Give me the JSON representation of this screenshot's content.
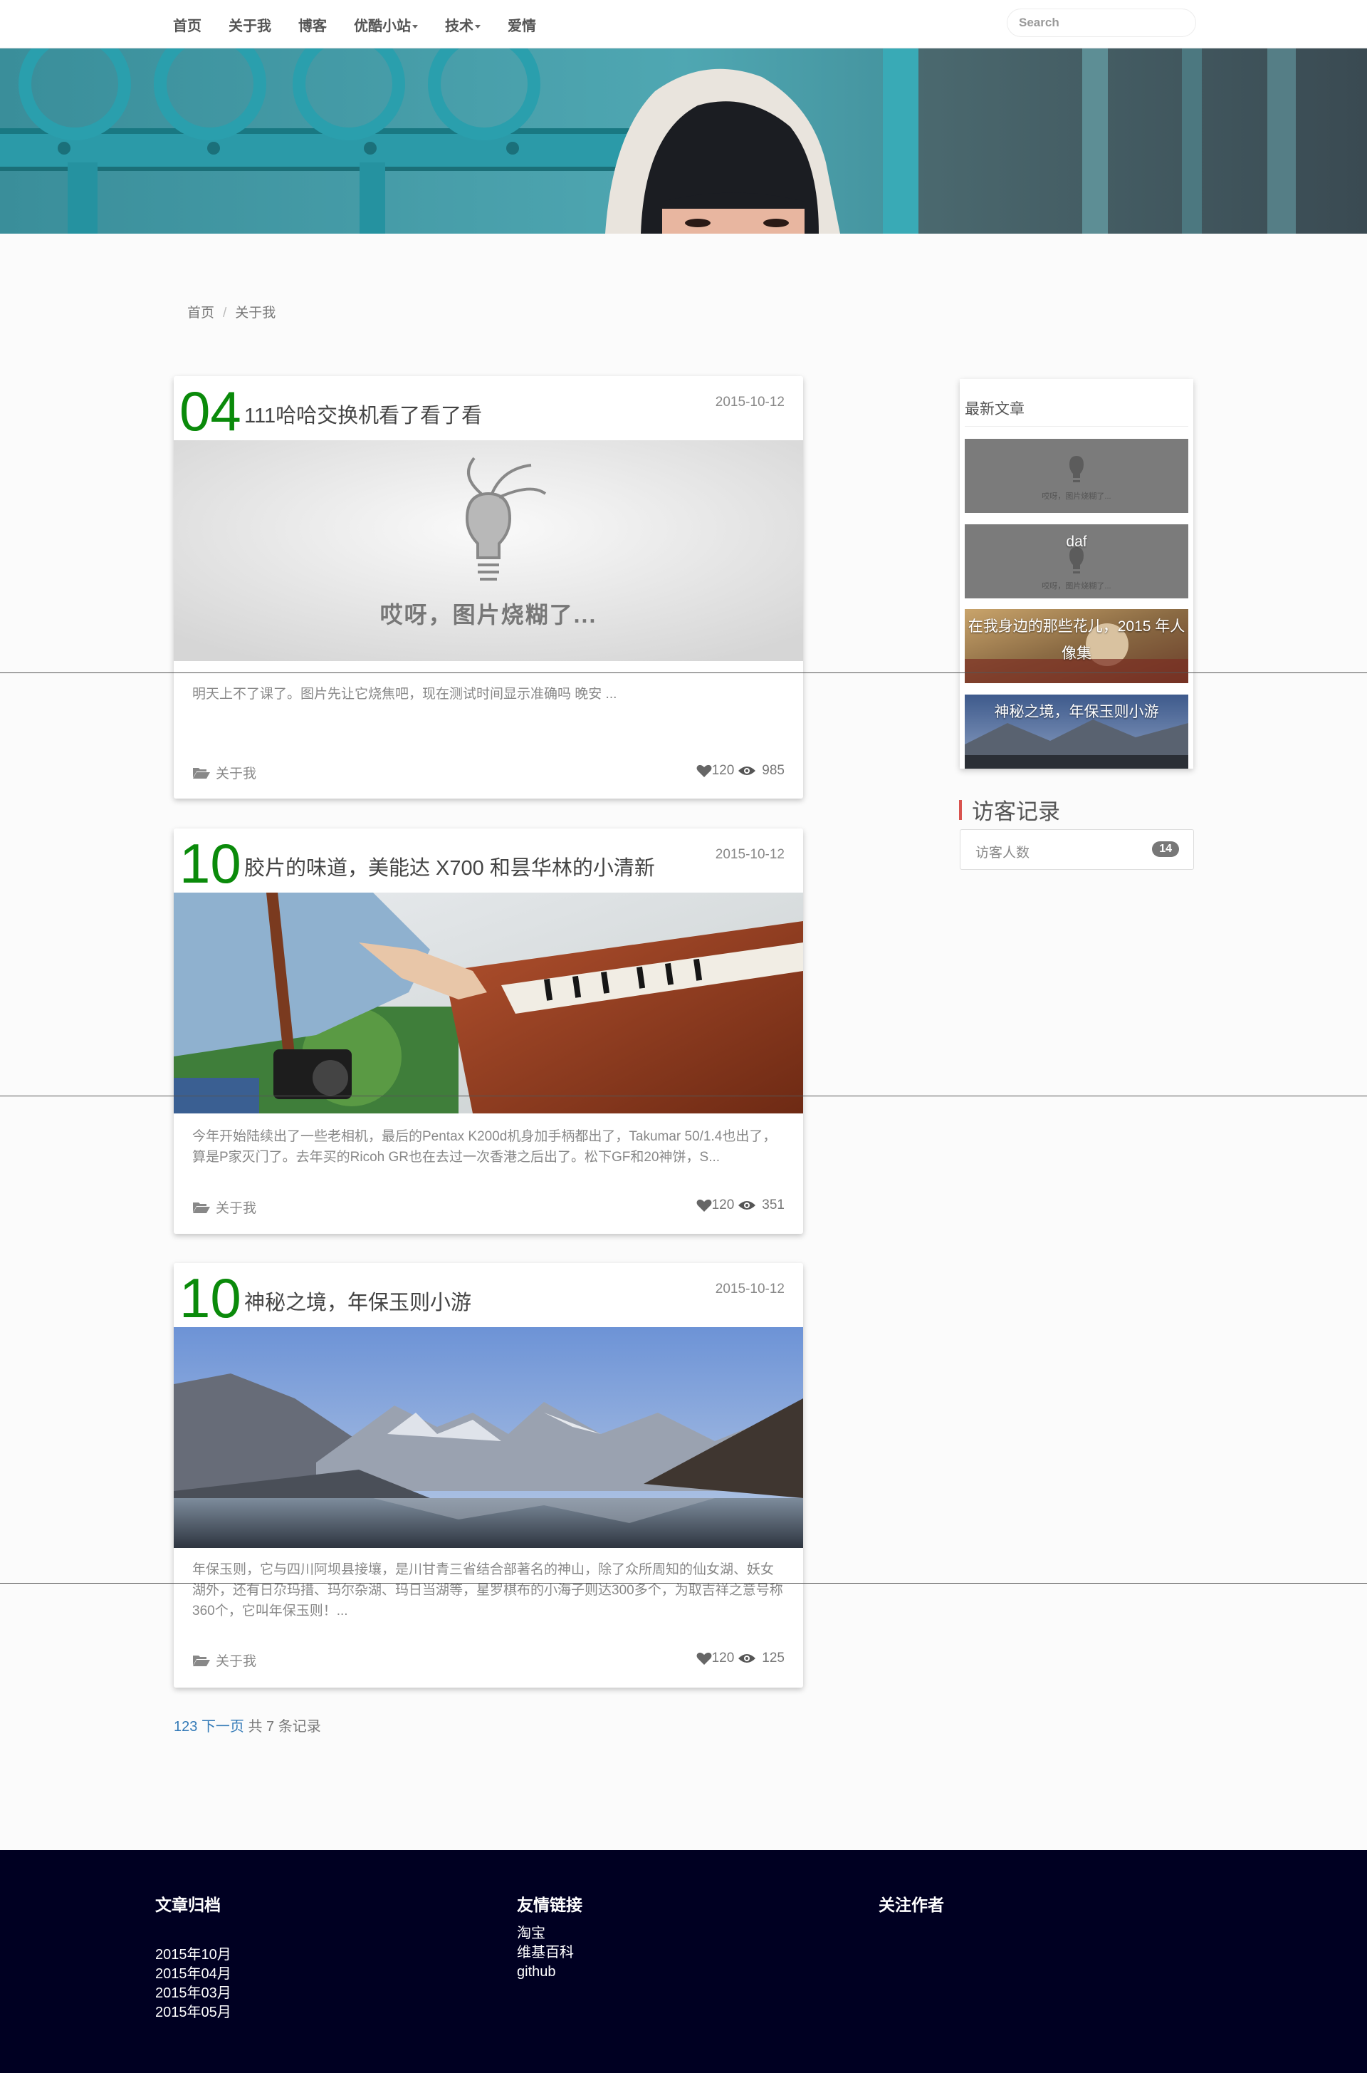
{
  "nav": {
    "items": [
      "首页",
      "关于我",
      "博客",
      "优酷小站",
      "技术",
      "爱情"
    ],
    "search_placeholder": "Search"
  },
  "breadcrumb": {
    "home": "首页",
    "current": "关于我"
  },
  "posts": [
    {
      "num": "04",
      "title": "111哈哈交换机看了看了看",
      "date": "2015-10-12",
      "placeholder_text": "哎呀，图片烧糊了...",
      "excerpt": "明天上不了课了。图片先让它烧焦吧，现在测试时间显示准确吗 晚安 ...",
      "category": "关于我",
      "likes": "120",
      "views": "985"
    },
    {
      "num": "10",
      "title": "胶片的味道，美能达 X700 和昙华林的小清新",
      "date": "2015-10-12",
      "excerpt": "今年开始陆续出了一些老相机，最后的Pentax K200d机身加手柄都出了，Takumar 50/1.4也出了，算是P家灭门了。去年买的Ricoh GR也在去过一次香港之后出了。松下GF和20神饼，S...",
      "category": "关于我",
      "likes": "120",
      "views": "351"
    },
    {
      "num": "10",
      "title": "神秘之境，年保玉则小游",
      "date": "2015-10-12",
      "excerpt": "年保玉则，它与四川阿坝县接壤，是川甘青三省结合部著名的神山，除了众所周知的仙女湖、妖女湖外，还有日尕玛措、玛尔杂湖、玛日当湖等，星罗棋布的小海子则达300多个，为取吉祥之意号称360个，它叫年保玉则！...",
      "category": "关于我",
      "likes": "120",
      "views": "125"
    }
  ],
  "pager": {
    "pages": "123",
    "next": "下一页",
    "total": "共 7 条记录"
  },
  "sidebar": {
    "title": "最新文章",
    "items": [
      {
        "caption": ""
      },
      {
        "caption": "daf"
      },
      {
        "caption": "在我身边的那些花儿，2015 年人像集"
      },
      {
        "caption": "神秘之境，年保玉则小游"
      }
    ],
    "placeholder_small": "哎呀，图片烧糊了..."
  },
  "visitor": {
    "title": "访客记录",
    "label": "访客人数",
    "count": "14"
  },
  "footer": {
    "archive_title": "文章归档",
    "archive": [
      "2015年10月",
      "2015年04月",
      "2015年03月",
      "2015年05月"
    ],
    "links_title": "友情链接",
    "links": [
      "淘宝",
      "维基百科",
      "github"
    ],
    "follow_title": "关注作者"
  },
  "colors": {
    "accent_number": "#0a8a0a",
    "visitor_bar": "#d9534f",
    "footer_bg": "#000022",
    "link": "#337ab7"
  }
}
